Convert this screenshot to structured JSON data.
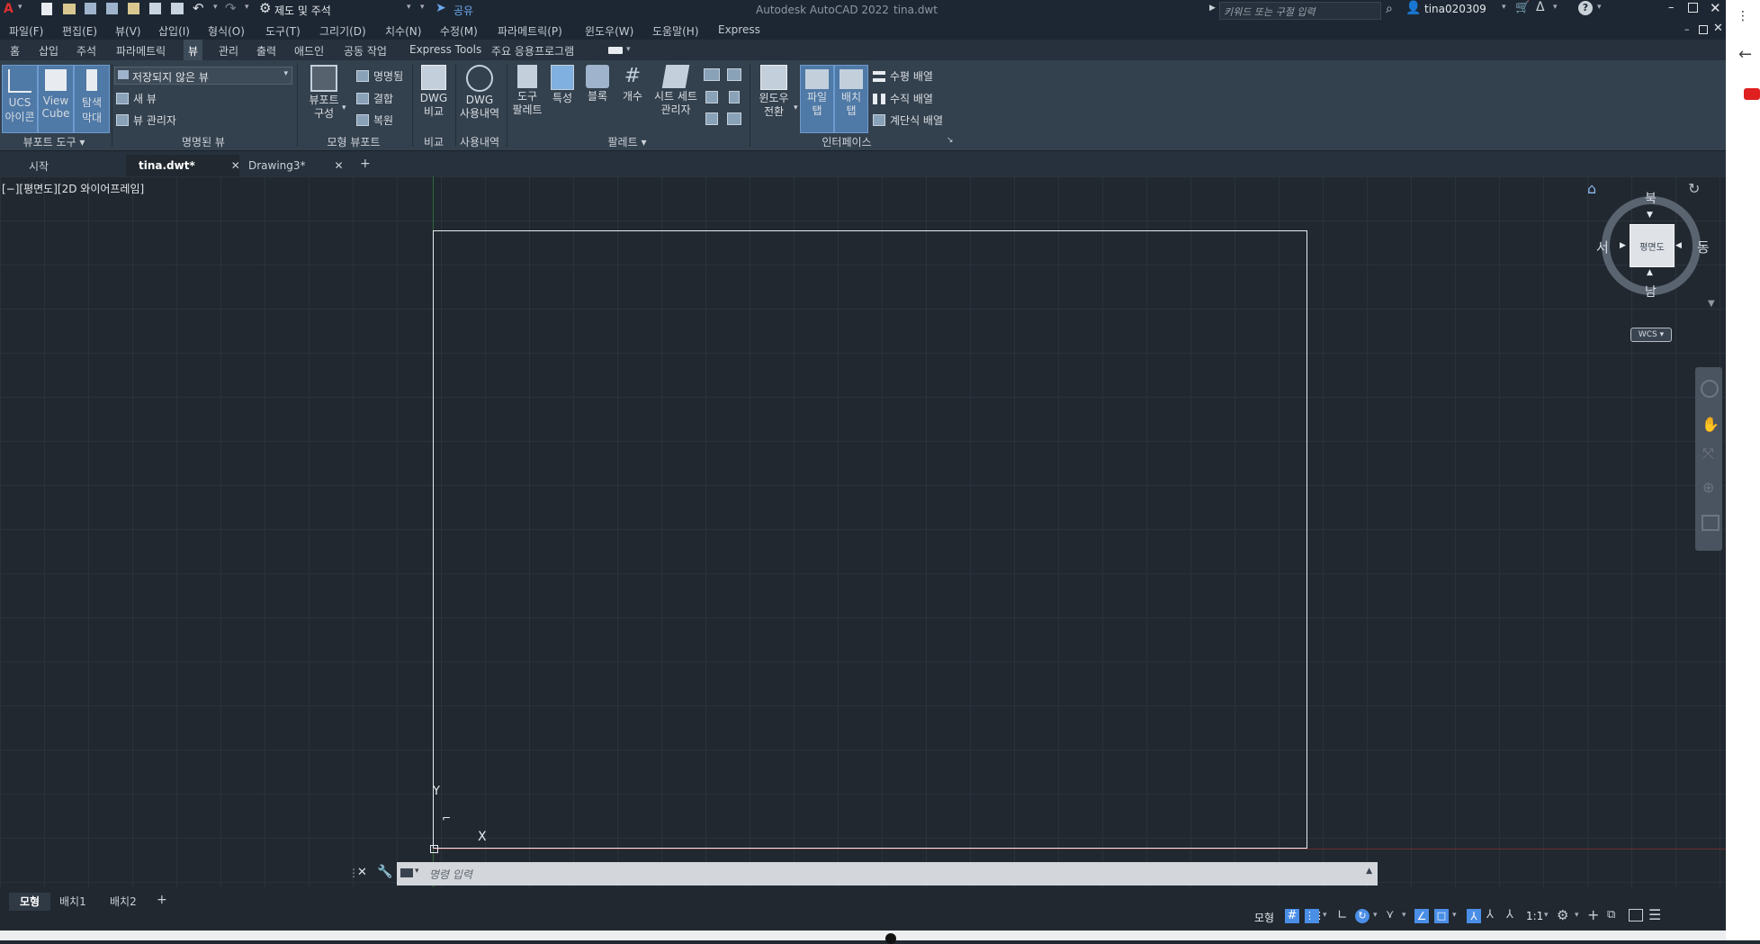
{
  "titlebar": {
    "workspace": "제도 및 주석",
    "share": "공유",
    "app_title": "Autodesk AutoCAD 2022",
    "file_title": "tina.dwt",
    "search_placeholder": "키워드 또는 구절 입력",
    "user": "tina020309"
  },
  "menubar": {
    "items": [
      "파일(F)",
      "편집(E)",
      "뷰(V)",
      "삽입(I)",
      "형식(O)",
      "도구(T)",
      "그리기(D)",
      "치수(N)",
      "수정(M)",
      "파라메트릭(P)",
      "윈도우(W)",
      "도움말(H)",
      "Express"
    ]
  },
  "ribbon_tabs": {
    "items": [
      "홈",
      "삽입",
      "주석",
      "파라메트릭",
      "뷰",
      "관리",
      "출력",
      "애드인",
      "공동 작업",
      "Express Tools",
      "주요 응용프로그램"
    ]
  },
  "ribbon": {
    "viewport_tools": {
      "ucs_icon": "UCS\n아이콘",
      "ucs_line1": "UCS",
      "ucs_line2": "아이콘",
      "viewcube_line1": "View",
      "viewcube_line2": "Cube",
      "navbar_line1": "탐색",
      "navbar_line2": "막대",
      "label": "뷰포트 도구"
    },
    "named_views": {
      "dropdown": "저장되지 않은 뷰",
      "new_view": "새 뷰",
      "view_manager": "뷰 관리자",
      "label": "명명된 뷰"
    },
    "model_viewports": {
      "config_line1": "뷰포트",
      "config_line2": "구성",
      "named": "명명됨",
      "join": "결합",
      "restore": "복원",
      "label": "모형 뷰포트"
    },
    "compare": {
      "line1": "DWG",
      "line2": "비교",
      "label": "비교"
    },
    "history": {
      "line1": "DWG",
      "line2": "사용내역",
      "label": "사용내역"
    },
    "palettes": {
      "tool_line1": "도구",
      "tool_line2": "팔레트",
      "properties": "특성",
      "blocks": "블록",
      "count": "개수",
      "sheetset_line1": "시트 세트",
      "sheetset_line2": "관리자",
      "label": "팔레트"
    },
    "interface": {
      "switch_line1": "윈도우",
      "switch_line2": "전환",
      "filetab_line1": "파일",
      "filetab_line2": "탭",
      "layouttab_line1": "배치",
      "layouttab_line2": "탭",
      "tile_h": "수평 배열",
      "tile_v": "수직 배열",
      "cascade": "계단식 배열",
      "label": "인터페이스"
    }
  },
  "doc_tabs": {
    "start": "시작",
    "tab1": "tina.dwt*",
    "tab2": "Drawing3*"
  },
  "viewport": {
    "label": "[−][평면도][2D 와이어프레임]"
  },
  "viewcube": {
    "north": "북",
    "south": "남",
    "east": "동",
    "west": "서",
    "face": "평면도",
    "wcs": "WCS"
  },
  "ucs": {
    "y": "Y",
    "x": "X"
  },
  "command": {
    "placeholder": "명령 입력"
  },
  "layout_tabs": {
    "model": "모형",
    "layout1": "배치1",
    "layout2": "배치2"
  },
  "statusbar": {
    "model": "모형",
    "scale": "1:1"
  },
  "colors": {
    "background": "#212830",
    "ribbon": "#33404d",
    "accent": "#4a8ee6"
  }
}
